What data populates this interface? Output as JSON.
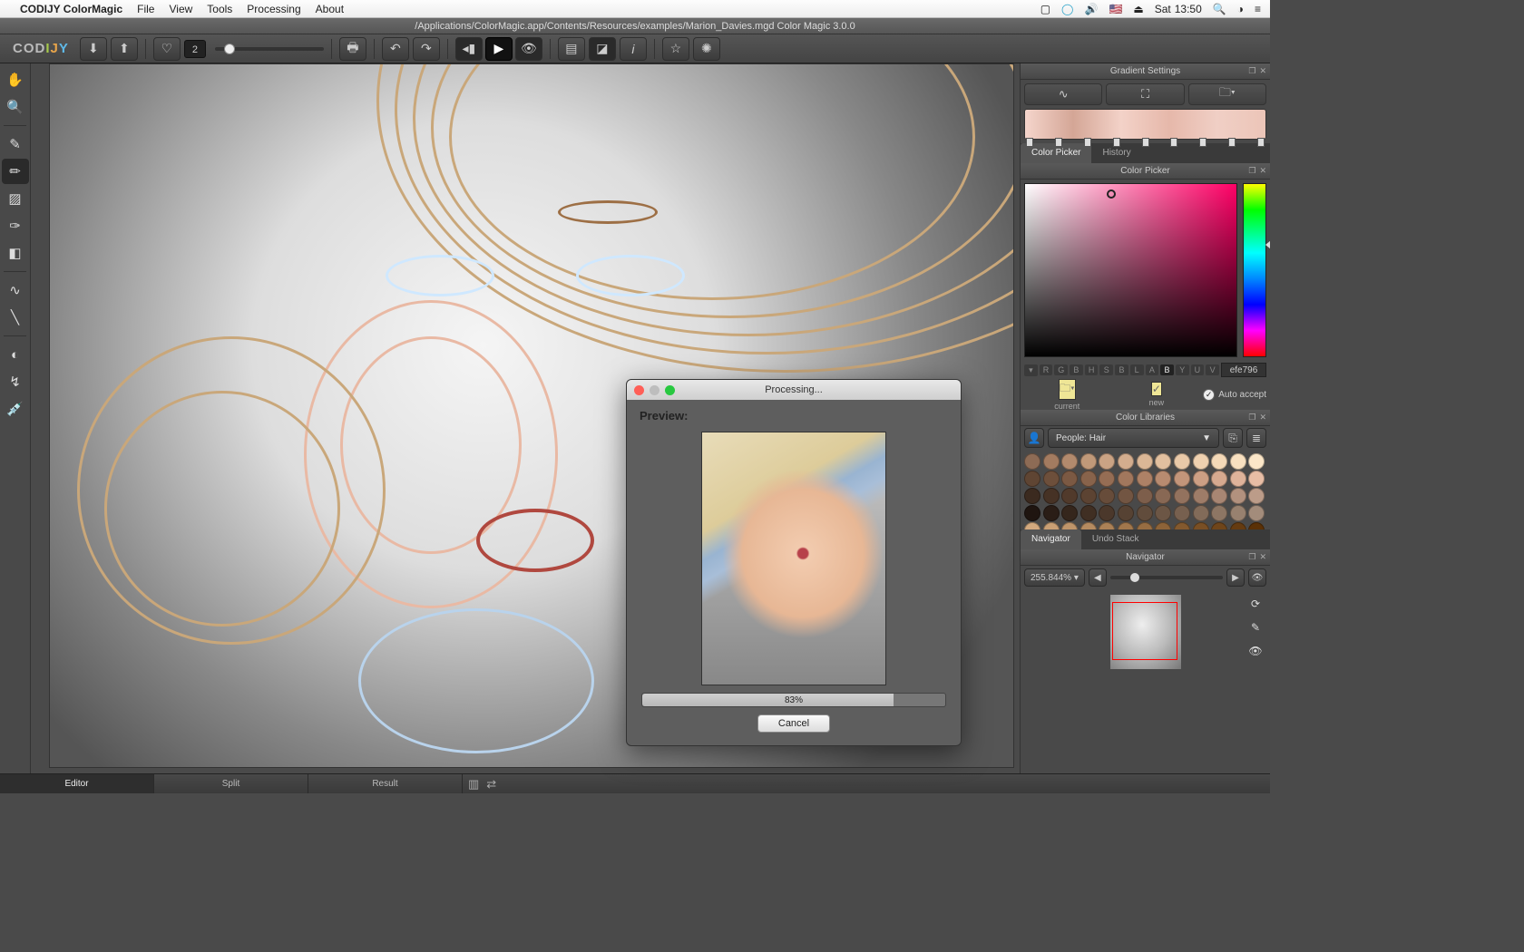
{
  "mac_menu": {
    "app_name": "CODIJY ColorMagic",
    "items": [
      "File",
      "View",
      "Tools",
      "Processing",
      "About"
    ],
    "right": {
      "flag": "🇺🇸",
      "day": "Sat",
      "time": "13:50"
    }
  },
  "window_title": "/Applications/ColorMagic.app/Contents/Resources/examples/Marion_Davies.mgd Color Magic 3.0.0",
  "logo_text": "CODIJY",
  "toolbar": {
    "stroke_size": "2"
  },
  "bottom_tabs": {
    "editor": "Editor",
    "split": "Split",
    "result": "Result"
  },
  "gradient_panel": {
    "title": "Gradient Settings",
    "stops_pct": [
      2,
      14,
      26,
      38,
      50,
      62,
      74,
      86,
      98
    ]
  },
  "picker_panel": {
    "tab_picker": "Color Picker",
    "tab_history": "History",
    "subtitle": "Color Picker",
    "channels": [
      "R",
      "G",
      "B",
      "H",
      "S",
      "B",
      "L",
      "A",
      "B",
      "Y",
      "U",
      "V"
    ],
    "active_channel_index": 8,
    "hex": "efe796",
    "current_label": "current",
    "new_label": "new",
    "auto_accept": "Auto accept"
  },
  "libraries_panel": {
    "title": "Color Libraries",
    "selected": "People: Hair",
    "swatches": [
      "#8d6b55",
      "#a37b60",
      "#b28a6d",
      "#c09979",
      "#caa384",
      "#d3ad8e",
      "#dbb796",
      "#e2c09f",
      "#e9c9a8",
      "#efd1b0",
      "#f4d9b8",
      "#f8e0c0",
      "#fbe6c8",
      "#5f4533",
      "#6d4f3b",
      "#7b5943",
      "#88634b",
      "#956d54",
      "#a1775d",
      "#ad8166",
      "#b88b70",
      "#c3957a",
      "#cd9f84",
      "#d6a98f",
      "#dfb39a",
      "#e7bda5",
      "#3b2a1f",
      "#463225",
      "#513a2b",
      "#5c4332",
      "#674c3a",
      "#725542",
      "#7d5e4b",
      "#886854",
      "#93725e",
      "#9e7c68",
      "#a88673",
      "#b2917e",
      "#bc9c89",
      "#1f1510",
      "#2a1d16",
      "#35261c",
      "#402f23",
      "#4b382b",
      "#564233",
      "#614c3c",
      "#6c5645",
      "#77604f",
      "#826b59",
      "#8d7664",
      "#98816f",
      "#a38c7b",
      "#d3a97e",
      "#c99f74",
      "#bf956a",
      "#b58b60",
      "#ab8156",
      "#a1774c",
      "#976d42",
      "#8d6338",
      "#83592e",
      "#794f24",
      "#6f451a",
      "#653b10",
      "#5b3106"
    ]
  },
  "navigator_panel": {
    "tab_nav": "Navigator",
    "tab_undo": "Undo Stack",
    "subtitle": "Navigator",
    "zoom": "255.844%"
  },
  "dialog": {
    "title": "Processing...",
    "preview_label": "Preview:",
    "percent": "83%",
    "cancel": "Cancel"
  }
}
